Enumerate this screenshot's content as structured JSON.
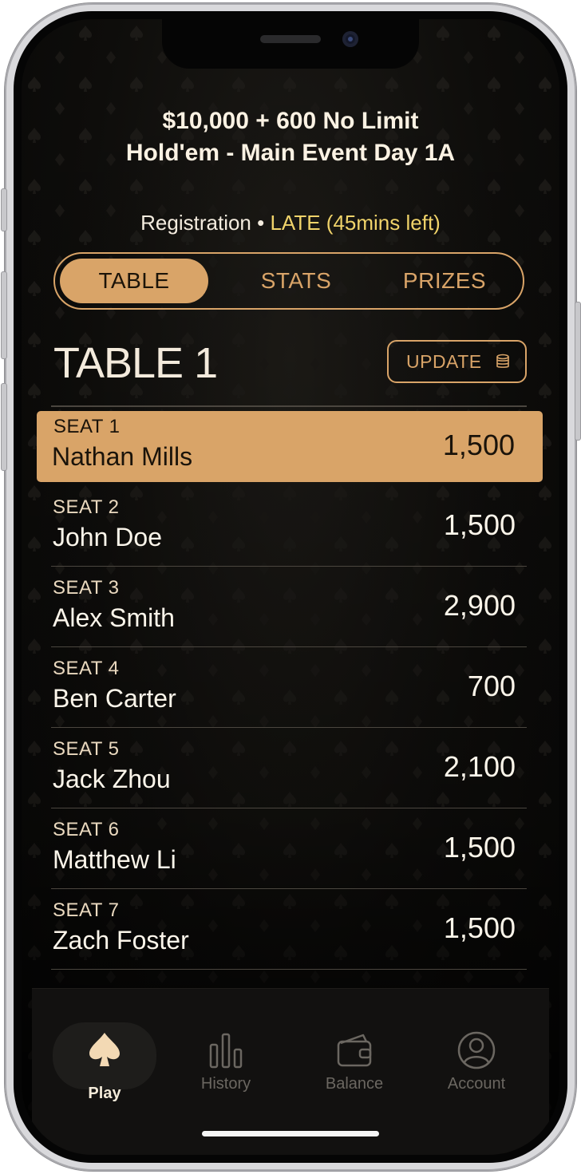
{
  "event": {
    "title_line1": "$10,000 + 600 No Limit",
    "title_line2": "Hold'em - Main Event Day 1A",
    "registration_label": "Registration",
    "separator": "•",
    "registration_status": "LATE (45mins left)"
  },
  "tabs": [
    {
      "label": "TABLE",
      "active": true
    },
    {
      "label": "STATS",
      "active": false
    },
    {
      "label": "PRIZES",
      "active": false
    }
  ],
  "table": {
    "title": "TABLE 1",
    "update_label": "UPDATE",
    "update_icon": "coins-icon"
  },
  "seats": [
    {
      "seat": "SEAT 1",
      "name": "Nathan Mills",
      "chips": "1,500",
      "highlighted": true
    },
    {
      "seat": "SEAT 2",
      "name": "John Doe",
      "chips": "1,500"
    },
    {
      "seat": "SEAT 3",
      "name": "Alex Smith",
      "chips": "2,900"
    },
    {
      "seat": "SEAT 4",
      "name": "Ben Carter",
      "chips": "700"
    },
    {
      "seat": "SEAT 5",
      "name": "Jack Zhou",
      "chips": "2,100"
    },
    {
      "seat": "SEAT 6",
      "name": "Matthew Li",
      "chips": "1,500"
    },
    {
      "seat": "SEAT 7",
      "name": "Zach Foster",
      "chips": "1,500"
    }
  ],
  "nav": [
    {
      "label": "Play",
      "icon": "spade-icon",
      "active": true
    },
    {
      "label": "History",
      "icon": "bar-chart-icon",
      "active": false
    },
    {
      "label": "Balance",
      "icon": "wallet-icon",
      "active": false
    },
    {
      "label": "Account",
      "icon": "user-circle-icon",
      "active": false
    }
  ],
  "colors": {
    "accent": "#d9a468",
    "late": "#f0d36a",
    "background": "#0e0d0b"
  }
}
